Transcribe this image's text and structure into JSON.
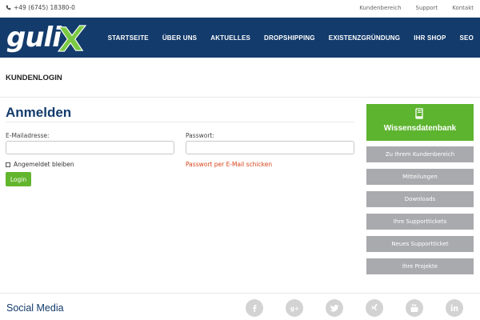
{
  "topbar": {
    "phone": "+49 (6745) 18380-0",
    "links": [
      "Kundenbereich",
      "Support",
      "Kontakt"
    ]
  },
  "header": {
    "logo_text": "guli",
    "logo_accent_color": "#7ac943",
    "background_color": "#133b6c",
    "nav": [
      "STARTSEITE",
      "ÜBER UNS",
      "AKTUELLES",
      "DROPSHIPPING",
      "EXISTENZGRÜNDUNG",
      "IHR SHOP",
      "SEO"
    ]
  },
  "page": {
    "title": "KUNDENLOGIN"
  },
  "login": {
    "heading": "Anmelden",
    "email_label": "E-Mailadresse:",
    "email_value": "",
    "password_label": "Passwort:",
    "password_value": "",
    "remember_label": "Angemeldet bleiben",
    "remember_checked": false,
    "forgot_label": "Passwort per E-Mail schicken",
    "submit_label": "Login"
  },
  "sidebar": {
    "knowledge_base": "Wissensdatenbank",
    "knowledge_icon": "book-icon",
    "items": [
      "Zu Ihrem Kundenbereich",
      "Mitteilungen",
      "Downloads",
      "Ihre Supporttickets",
      "Neues Supportticket",
      "Ihre Projekte"
    ]
  },
  "footer": {
    "title": "Social Media",
    "icons": [
      "facebook-icon",
      "google-plus-icon",
      "twitter-icon",
      "xing-icon",
      "youtube-icon",
      "linkedin-icon"
    ]
  }
}
